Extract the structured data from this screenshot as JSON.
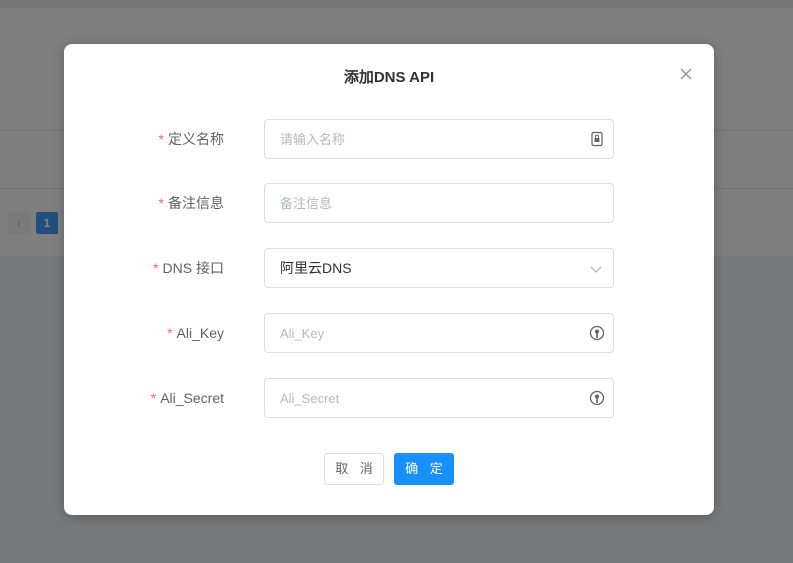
{
  "background": {
    "pagination": {
      "prev_icon": "chevron-left-icon",
      "current_page": "1"
    }
  },
  "dialog": {
    "title": "添加DNS API",
    "close_icon": "close-icon",
    "fields": {
      "name": {
        "label": "定义名称",
        "placeholder": "请输入名称",
        "value": "",
        "required": true,
        "suffix_icon": "password-manager-icon"
      },
      "note": {
        "label": "备注信息",
        "placeholder": "备注信息",
        "value": "",
        "required": true
      },
      "dns": {
        "label": "DNS 接口",
        "value": "阿里云DNS",
        "required": true,
        "suffix_icon": "chevron-down-icon"
      },
      "ali_key": {
        "label": "Ali_Key",
        "placeholder": "Ali_Key",
        "value": "",
        "required": true,
        "suffix_icon": "autofill-key-icon"
      },
      "ali_secret": {
        "label": "Ali_Secret",
        "placeholder": "Ali_Secret",
        "value": "",
        "required": true,
        "suffix_icon": "autofill-key-icon"
      }
    },
    "buttons": {
      "cancel": "取 消",
      "ok": "确 定"
    }
  },
  "colors": {
    "primary": "#1890ff",
    "required": "#f56c6c",
    "overlay": "rgba(0,0,0,0.5)"
  }
}
